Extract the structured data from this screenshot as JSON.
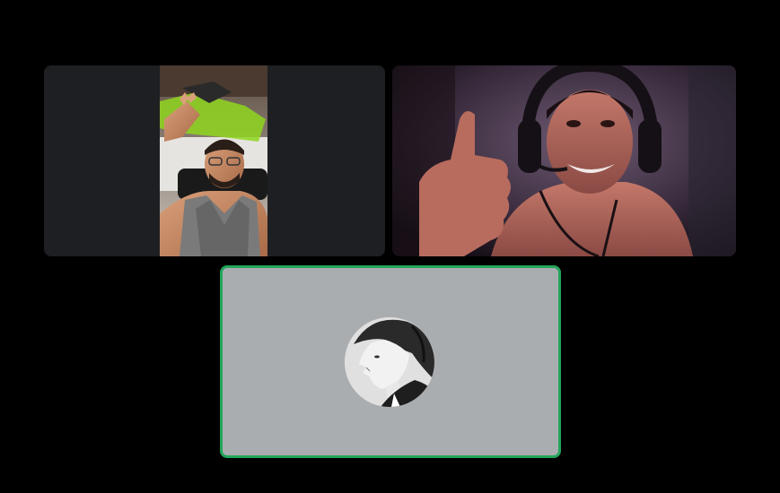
{
  "call": {
    "participants": [
      {
        "id": "participant-1",
        "has_video": true,
        "speaking": false
      },
      {
        "id": "participant-2",
        "has_video": true,
        "speaking": false
      },
      {
        "id": "participant-3",
        "has_video": false,
        "speaking": true,
        "avatar": "anime-character-profile-avatar"
      }
    ]
  },
  "colors": {
    "background": "#000000",
    "tile_empty": "#1e1f22",
    "avatar_tile": "#aaadb0",
    "speaking_ring": "#23a55a"
  }
}
